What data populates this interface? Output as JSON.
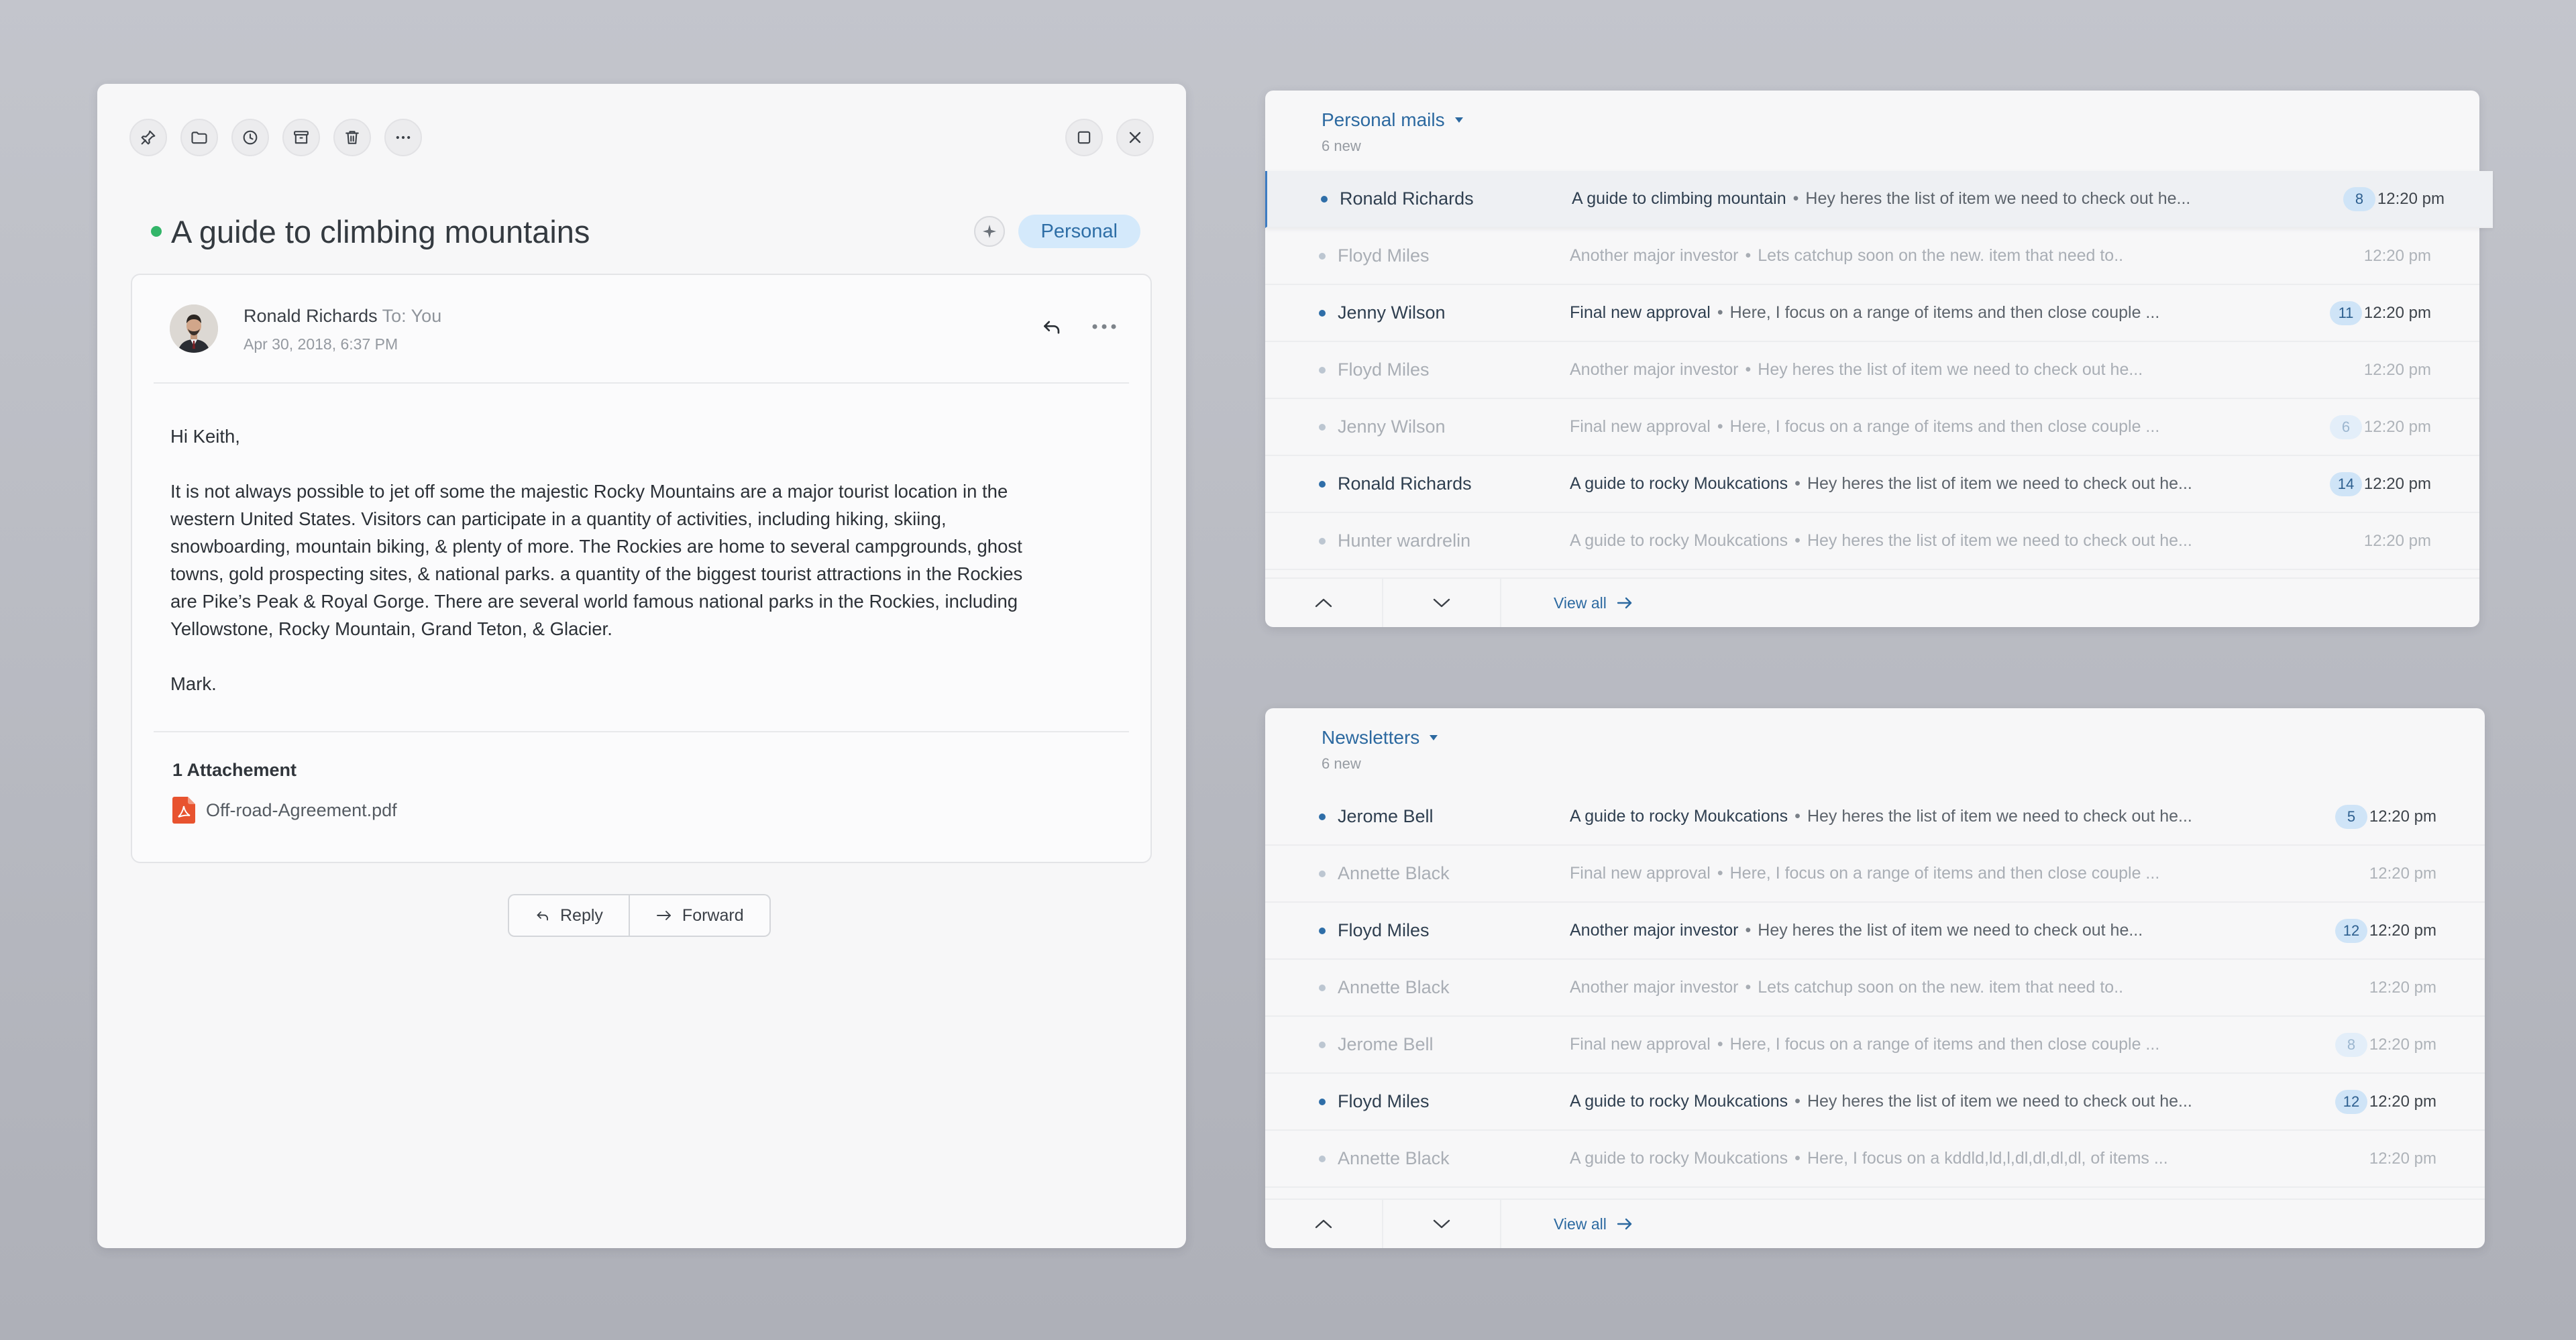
{
  "email": {
    "subject": "A guide to climbing mountains",
    "tag": "Personal",
    "sender": "Ronald Richards",
    "recipient": "To: You",
    "date": "Apr 30, 2018, 6:37 PM",
    "greeting": "Hi Keith,",
    "paragraph": "It is not always possible to jet off some the majestic Rocky Mountains are a major tourist location in the western United States. Visitors can participate in a quantity of activities, including hiking, skiing, snowboarding, mountain biking, & plenty of more. The Rockies are home to several campgrounds, ghost towns, gold prospecting sites, & national parks. a quantity of the biggest tourist attractions in the Rockies are Pike’s Peak & Royal Gorge. There are several world famous national parks in the Rockies, including Yellowstone, Rocky Mountain, Grand Teton, & Glacier.",
    "signoff": "Mark.",
    "attachments_title": "1 Attachement",
    "attachment_name": "Off-road-Agreement.pdf",
    "reply_label": "Reply",
    "forward_label": "Forward"
  },
  "personal": {
    "title": "Personal mails",
    "subtitle": "6 new",
    "view_all": "View all",
    "rows": [
      {
        "name": "Ronald Richards",
        "subject": "A guide to climbing mountain",
        "preview": "Hey heres the list of item we need to check out he...",
        "badge": "8",
        "time": "12:20 pm"
      },
      {
        "name": "Floyd Miles",
        "subject": "Another major investor",
        "preview": "Lets catchup soon on the  new. item that need to..",
        "badge": "",
        "time": "12:20 pm"
      },
      {
        "name": "Jenny Wilson",
        "subject": "Final new approval",
        "preview": "Here, I focus on a range of items and then close couple  ...",
        "badge": "11",
        "time": "12:20 pm"
      },
      {
        "name": "Floyd Miles",
        "subject": "Another major investor",
        "preview": "Hey heres the list of item we need to check out he...",
        "badge": "",
        "time": "12:20 pm"
      },
      {
        "name": "Jenny Wilson",
        "subject": "Final new approval",
        "preview": "Here, I focus on a range of items and then close couple  ...",
        "badge": "6",
        "time": "12:20 pm"
      },
      {
        "name": "Ronald Richards",
        "subject": "A guide to rocky Moukcations",
        "preview": "Hey heres the list of item we need to check out he...",
        "badge": "14",
        "time": "12:20 pm"
      },
      {
        "name": "Hunter wardrelin",
        "subject": "A guide to rocky Moukcations",
        "preview": "Hey heres the list of item we need to check out he...",
        "badge": "",
        "time": "12:20 pm"
      }
    ]
  },
  "newsletters": {
    "title": "Newsletters",
    "subtitle": "6 new",
    "view_all": "View all",
    "rows": [
      {
        "name": "Jerome Bell",
        "subject": "A guide to rocky Moukcations",
        "preview": "Hey heres the list of item we need to check out he...",
        "badge": "5",
        "time": "12:20 pm"
      },
      {
        "name": "Annette Black",
        "subject": "Final new approval",
        "preview": "Here, I focus on a range of items and then close couple  ...",
        "badge": "",
        "time": "12:20 pm"
      },
      {
        "name": "Floyd Miles",
        "subject": "Another major investor",
        "preview": "Hey heres the list of item we need to check out he...",
        "badge": "12",
        "time": "12:20 pm"
      },
      {
        "name": "Annette Black",
        "subject": "Another major investor",
        "preview": "Lets catchup soon on the  new. item that need to..",
        "badge": "",
        "time": "12:20 pm"
      },
      {
        "name": "Jerome Bell",
        "subject": "Final new approval",
        "preview": "Here, I focus on a range of items and then close couple  ...",
        "badge": "8",
        "time": "12:20 pm"
      },
      {
        "name": "Floyd Miles",
        "subject": "A guide to rocky Moukcations",
        "preview": "Hey heres the list of item we need to check out he...",
        "badge": "12",
        "time": "12:20 pm"
      },
      {
        "name": "Annette Black",
        "subject": "A guide to rocky Moukcations",
        "preview": "Here, I focus on a kddld,ld,l,dl,dl,dl,dl, of items  ...",
        "badge": "",
        "time": "12:20 pm"
      }
    ]
  },
  "icons": {
    "toolbar": [
      "pin-icon",
      "folder-icon",
      "clock-icon",
      "archive-icon",
      "trash-icon",
      "more-icon"
    ],
    "window": [
      "maximize-icon",
      "close-icon"
    ]
  },
  "colors": {
    "accent": "#2c69a0",
    "unread": "#33b569",
    "badge": "#cfe4f7",
    "pdf": "#e8532f"
  }
}
